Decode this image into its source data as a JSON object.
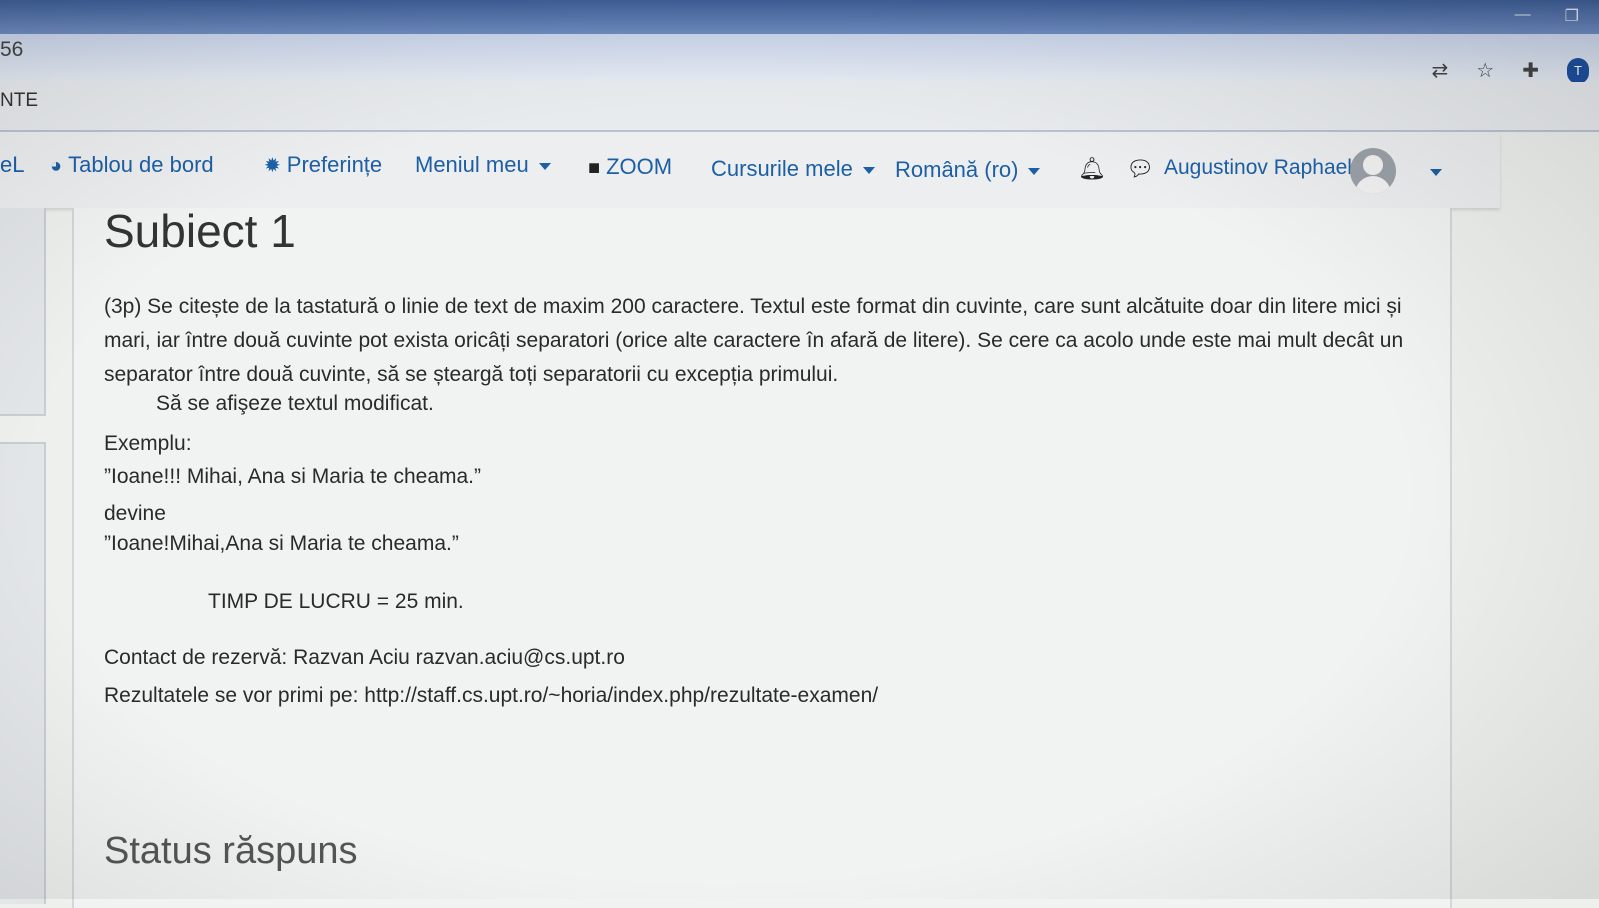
{
  "browser": {
    "tab_fragment": "56",
    "bookmark_fragment": "NTE",
    "icons": [
      "translate-icon",
      "star-icon",
      "extensions-icon",
      "profile-icon"
    ],
    "profile_letter": "T"
  },
  "navbar": {
    "brand_fragment": "eL",
    "dashboard": "Tablou de bord",
    "preferences": "Preferințe",
    "my_menu": "Meniul meu",
    "zoom": "ZOOM",
    "my_courses": "Cursurile mele",
    "language": "Română (ro)",
    "user_name": "Augustinov Raphael"
  },
  "question": {
    "title": "Subiect 1",
    "paragraph": "(3p) Se citește de la tastatură o linie de text de maxim 200 caractere. Textul este format din cuvinte, care sunt alcătuite doar din litere mici și mari, iar între două cuvinte pot exista oricâți separatori (orice alte caractere în afară de litere). Se cere ca acolo unde este mai mult decât un separator între două cuvinte, să se șteargă toți separatorii cu excepția primului.",
    "task": "Să se afişeze textul modificat.",
    "example_label": "Exemplu:",
    "example_input": "”Ioane!!! Mihai, Ana si    Maria te cheama.”",
    "becomes": "devine",
    "example_output": "”Ioane!Mihai,Ana si Maria te cheama.”",
    "time": "TIMP DE LUCRU = 25 min.",
    "contact": "Contact de rezervă: Razvan Aciu razvan.aciu@cs.upt.ro",
    "results": "Rezultatele se vor primi pe: http://staff.cs.upt.ro/~horia/index.php/rezultate-examen/"
  },
  "status_heading": "Status răspuns",
  "colors": {
    "link": "#1d5fa6",
    "titlebar": "#3f5f98",
    "page_bg": "#eef0ee"
  }
}
